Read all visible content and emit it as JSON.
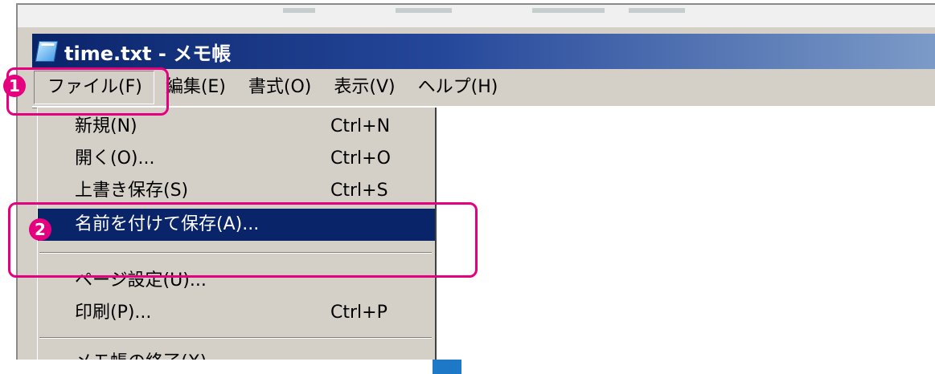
{
  "window": {
    "title": "time.txt - メモ帳"
  },
  "menubar": {
    "items": [
      {
        "label": "ファイル(F)"
      },
      {
        "label": "編集(E)"
      },
      {
        "label": "書式(O)"
      },
      {
        "label": "表示(V)"
      },
      {
        "label": "ヘルプ(H)"
      }
    ]
  },
  "file_menu": {
    "items": [
      {
        "label": "新規(N)",
        "shortcut": "Ctrl+N"
      },
      {
        "label": "開く(O)...",
        "shortcut": "Ctrl+O"
      },
      {
        "label": "上書き保存(S)",
        "shortcut": "Ctrl+S"
      },
      {
        "label": "名前を付けて保存(A)...",
        "shortcut": "",
        "selected": true
      },
      {
        "label": "ページ設定(U)...",
        "shortcut": ""
      },
      {
        "label": "印刷(P)...",
        "shortcut": "Ctrl+P"
      },
      {
        "label": "メモ帳の終了(X)",
        "shortcut": ""
      }
    ]
  },
  "annotations": {
    "step1": "1",
    "step2": "2"
  },
  "colors": {
    "highlight": "#e4007f",
    "title_bar": "#0a246a",
    "selection": "#0a246a"
  }
}
